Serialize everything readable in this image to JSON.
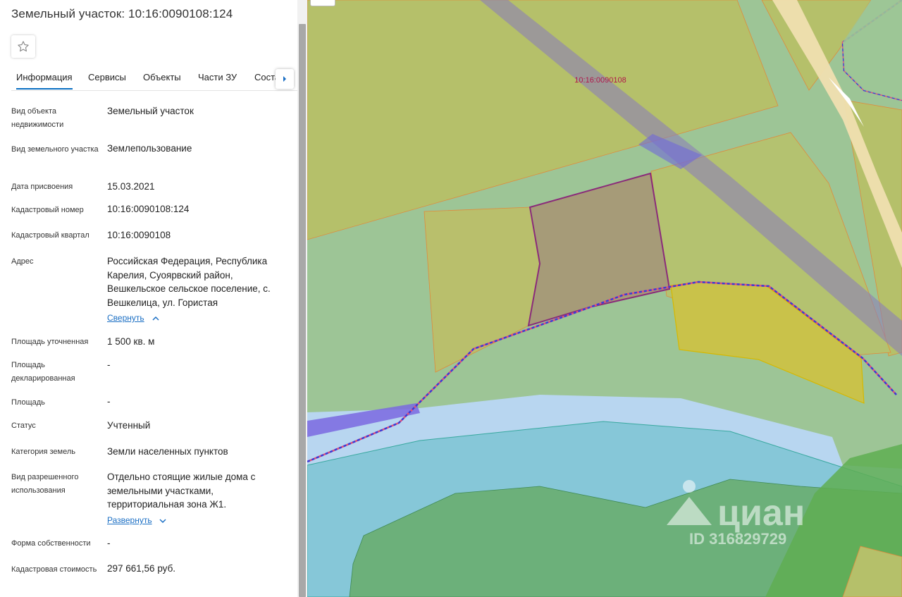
{
  "panel": {
    "title": "Земельный участок: 10:16:0090108:124",
    "tabs": [
      "Информация",
      "Сервисы",
      "Объекты",
      "Части ЗУ",
      "Состав"
    ],
    "fields": {
      "object_type_label": "Вид объекта недвижимости",
      "object_type_value": "Земельный участок",
      "plot_type_label": "Вид земельного участка",
      "plot_type_value": "Землепользование",
      "date_label": "Дата присвоения",
      "date_value": "15.03.2021",
      "cad_number_label": "Кадастровый номер",
      "cad_number_value": "10:16:0090108:124",
      "cad_quarter_label": "Кадастровый квартал",
      "cad_quarter_value": "10:16:0090108",
      "address_label": "Адрес",
      "address_value": "Российская Федерация, Республика Карелия, Суоярвский район, Вешкельское сельское поселение, с. Вешкелица, ул. Гористая",
      "collapse_link": "Свернуть",
      "area_refined_label": "Площадь уточненная",
      "area_refined_value": "1 500 кв. м",
      "area_declared_label": "Площадь декларированная",
      "area_declared_value": "-",
      "area_label": "Площадь",
      "area_value": "-",
      "status_label": "Статус",
      "status_value": "Учтенный",
      "category_label": "Категория земель",
      "category_value": "Земли населенных пунктов",
      "permitted_use_label": "Вид разрешенного использования",
      "permitted_use_value": "Отдельно стоящие жилые дома с земельными участками, территориальная зона Ж1.",
      "expand_link": "Развернуть",
      "ownership_label": "Форма собственности",
      "ownership_value": "-",
      "cad_value_label": "Кадастровая стоимость",
      "cad_value_value": "297 661,56 руб."
    }
  },
  "map": {
    "quarter_label": "10:16:0090108",
    "watermark_brand": "циан",
    "watermark_id": "ID 316829729"
  },
  "icons": {
    "favorite": "star-outline-icon",
    "tabs_next": "caret-right-icon",
    "collapse": "chevron-up-icon",
    "expand": "chevron-down-icon"
  },
  "colors": {
    "link": "#1b6fc4",
    "active_tab": "#0a6fc2",
    "selected_parcel_outline": "#8a2b7a",
    "boundary_dashed": "#3b3bd6",
    "water": "#8ec9e6",
    "forest": "#5fae64"
  }
}
